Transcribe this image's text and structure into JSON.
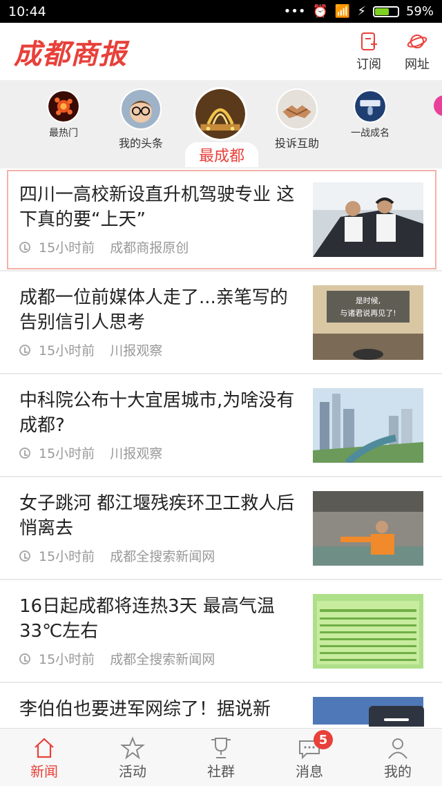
{
  "status": {
    "time": "10:44",
    "battery": "59%"
  },
  "header": {
    "logo": "成都商报",
    "subscribe": "订阅",
    "website": "网址"
  },
  "channels": [
    {
      "label": "最热门"
    },
    {
      "label": "我的头条"
    },
    {
      "label": "最成都"
    },
    {
      "label": "投诉互助"
    },
    {
      "label": "一战成名"
    }
  ],
  "news": [
    {
      "title": "四川一高校新设直升机驾驶专业 这下真的要“上天”",
      "time": "15小时前",
      "source": "成都商报原创"
    },
    {
      "title": "成都一位前媒体人走了...亲笔写的告别信引人思考",
      "time": "15小时前",
      "source": "川报观察",
      "thumb_text": [
        "是时候,",
        "与诸君说再见了!"
      ]
    },
    {
      "title": "中科院公布十大宜居城市,为啥没有成都?",
      "time": "15小时前",
      "source": "川报观察"
    },
    {
      "title": "女子跳河 都江堰残疾环卫工救人后悄离去",
      "time": "15小时前",
      "source": "成都全搜索新闻网"
    },
    {
      "title": "16日起成都将连热3天 最高气温33℃左右",
      "time": "15小时前",
      "source": "成都全搜索新闻网"
    },
    {
      "title": "李伯伯也要进军网综了！据说新"
    }
  ],
  "tabs": [
    {
      "label": "新闻"
    },
    {
      "label": "活动"
    },
    {
      "label": "社群"
    },
    {
      "label": "消息",
      "badge": "5"
    },
    {
      "label": "我的"
    }
  ],
  "colors": {
    "accent": "#e8403a"
  }
}
